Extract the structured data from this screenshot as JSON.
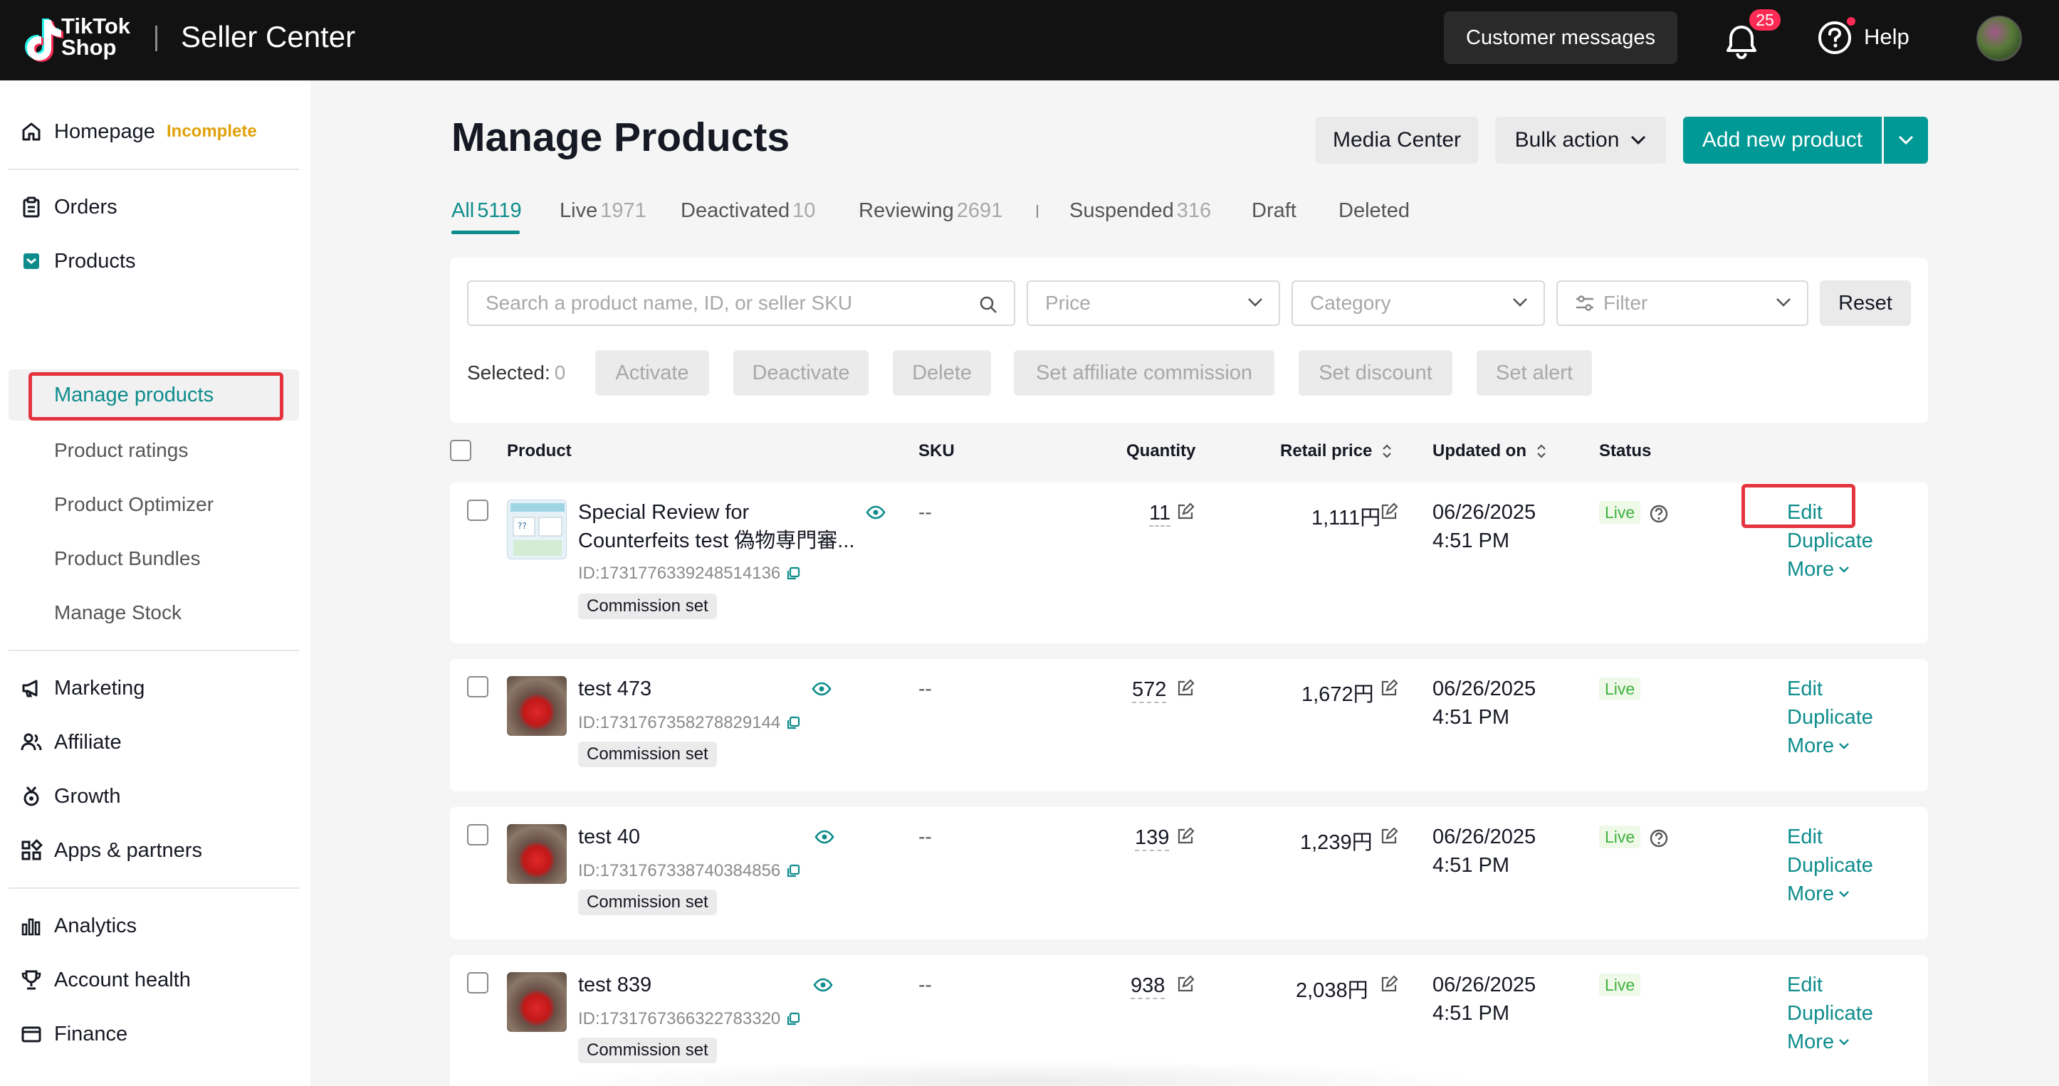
{
  "brand": {
    "logo_line1": "TikTok",
    "logo_line2": "Shop",
    "app_title": "Seller Center"
  },
  "header": {
    "customer_messages": "Customer messages",
    "notifications_count": "25",
    "help_label": "Help"
  },
  "sidebar": {
    "homepage": "Homepage",
    "homepage_status": "Incomplete",
    "orders": "Orders",
    "products": "Products",
    "products_sub": [
      "Manage products",
      "Product ratings",
      "Product Optimizer",
      "Product Bundles",
      "Manage Stock"
    ],
    "marketing": "Marketing",
    "affiliate": "Affiliate",
    "growth": "Growth",
    "apps": "Apps & partners",
    "analytics": "Analytics",
    "account_health": "Account health",
    "finance": "Finance"
  },
  "page": {
    "title": "Manage Products",
    "media_center": "Media Center",
    "bulk_action": "Bulk action",
    "add_new_product": "Add new product"
  },
  "tabs": [
    {
      "label": "All",
      "count": "5119"
    },
    {
      "label": "Live",
      "count": "1971"
    },
    {
      "label": "Deactivated",
      "count": "10"
    },
    {
      "label": "Reviewing",
      "count": "2691"
    },
    {
      "label": "Suspended",
      "count": "316"
    },
    {
      "label": "Draft",
      "count": ""
    },
    {
      "label": "Deleted",
      "count": ""
    }
  ],
  "filters": {
    "search_placeholder": "Search a product name, ID, or seller SKU",
    "price": "Price",
    "category": "Category",
    "filter": "Filter",
    "reset": "Reset"
  },
  "selection": {
    "label": "Selected:",
    "count": "0",
    "actions": [
      "Activate",
      "Deactivate",
      "Delete",
      "Set affiliate commission",
      "Set discount",
      "Set alert"
    ]
  },
  "table": {
    "headers": {
      "product": "Product",
      "sku": "SKU",
      "quantity": "Quantity",
      "retail_price": "Retail price",
      "updated_on": "Updated on",
      "status": "Status"
    },
    "rows": [
      {
        "name_line1": "Special Review for",
        "name_line2": "Counterfeits test 偽物専門審...",
        "id": "ID:1731776339248514136",
        "commission": "Commission set",
        "sku": "--",
        "quantity": "11",
        "price": "1,111円",
        "date": "06/26/2025",
        "time": "4:51 PM",
        "status": "Live",
        "edit": "Edit",
        "duplicate": "Duplicate",
        "more": "More"
      },
      {
        "name_line1": "test 473",
        "name_line2": "",
        "id": "ID:1731767358278829144",
        "commission": "Commission set",
        "sku": "--",
        "quantity": "572",
        "price": "1,672円",
        "date": "06/26/2025",
        "time": "4:51 PM",
        "status": "Live",
        "edit": "Edit",
        "duplicate": "Duplicate",
        "more": "More"
      },
      {
        "name_line1": "test 40",
        "name_line2": "",
        "id": "ID:1731767338740384856",
        "commission": "Commission set",
        "sku": "--",
        "quantity": "139",
        "price": "1,239円",
        "date": "06/26/2025",
        "time": "4:51 PM",
        "status": "Live",
        "edit": "Edit",
        "duplicate": "Duplicate",
        "more": "More"
      },
      {
        "name_line1": "test 839",
        "name_line2": "",
        "id": "ID:1731767366322783320",
        "commission": "Commission set",
        "sku": "--",
        "quantity": "938",
        "price": "2,038円",
        "date": "06/26/2025",
        "time": "4:51 PM",
        "status": "Live",
        "edit": "Edit",
        "duplicate": "Duplicate",
        "more": "More"
      }
    ]
  },
  "colors": {
    "brand_teal": "#009995",
    "link_teal": "#0e8c8c",
    "highlight_red": "#e5343f",
    "live_green": "#3fb23f",
    "incomplete_amber": "#e0a10a"
  }
}
